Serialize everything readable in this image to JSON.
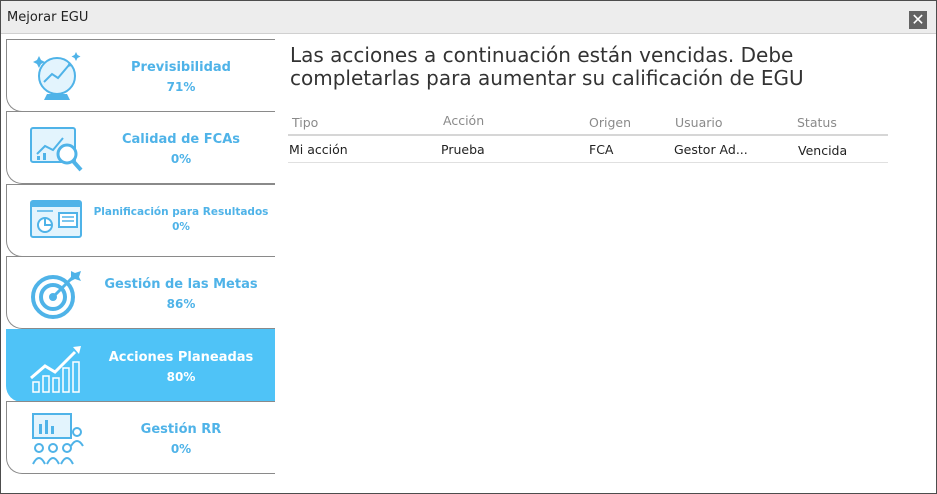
{
  "window": {
    "title": "Mejorar EGU",
    "close_label": "✕"
  },
  "sidebar": {
    "items": [
      {
        "label": "Previsibilidad",
        "percent": "71%",
        "icon": "crystal-ball-chart-icon",
        "active": false
      },
      {
        "label": "Calidad de FCAs",
        "percent": "0%",
        "icon": "magnifier-chart-icon",
        "active": false
      },
      {
        "label": "Planificación para Resultados",
        "percent": "0%",
        "icon": "presentation-board-icon",
        "active": false
      },
      {
        "label": "Gestión de las Metas",
        "percent": "86%",
        "icon": "target-icon",
        "active": false
      },
      {
        "label": "Acciones Planeadas",
        "percent": "80%",
        "icon": "growth-chart-icon",
        "active": true
      },
      {
        "label": "Gestión RR",
        "percent": "0%",
        "icon": "team-presentation-icon",
        "active": false
      }
    ]
  },
  "main": {
    "heading": "Las acciones a continuación están vencidas. Debe completarlas para aumentar su calificación de EGU",
    "table": {
      "columns": [
        "Tipo",
        "Acción",
        "Origen",
        "Usuario",
        "Status"
      ],
      "rows": [
        [
          "Mi acción",
          "Prueba",
          "FCA",
          "Gestor Ad...",
          "Vencida"
        ]
      ]
    }
  },
  "colors": {
    "accent": "#4fc3f7",
    "label_blue": "#4fb3e8",
    "titlebar": "#ededed"
  }
}
